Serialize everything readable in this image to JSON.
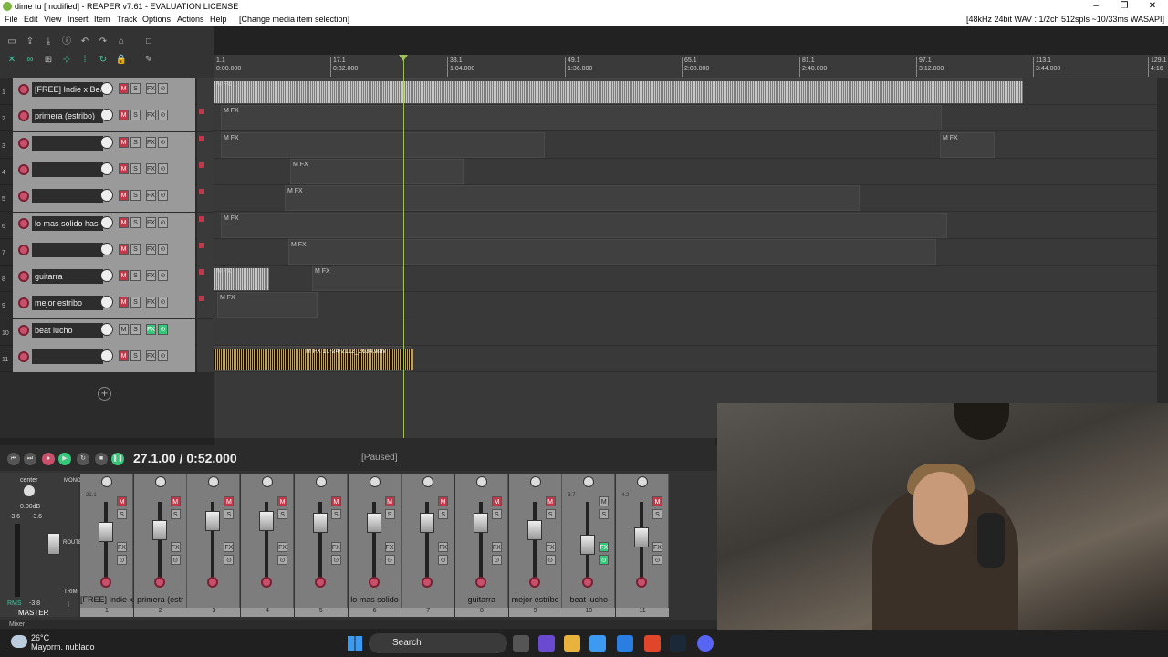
{
  "window": {
    "title": "dime tu [modified] - REAPER v7.61 - EVALUATION LICENSE",
    "minimize": "–",
    "maximize": "❐",
    "close": "✕"
  },
  "menu": {
    "items": [
      "File",
      "Edit",
      "View",
      "Insert",
      "Item",
      "Track",
      "Options",
      "Actions",
      "Help",
      "[Change media item selection]"
    ],
    "audio_status": "[48kHz 24bit WAV : 1/2ch 512spls ~10/33ms WASAPI]"
  },
  "ruler": {
    "marks": [
      {
        "bar": "1.1",
        "time": "0:00.000"
      },
      {
        "bar": "17.1",
        "time": "0:32.000"
      },
      {
        "bar": "33.1",
        "time": "1:04.000"
      },
      {
        "bar": "49.1",
        "time": "1:36.000"
      },
      {
        "bar": "65.1",
        "time": "2:08.000"
      },
      {
        "bar": "81.1",
        "time": "2:40.000"
      },
      {
        "bar": "97.1",
        "time": "3:12.000"
      },
      {
        "bar": "113.1",
        "time": "3:44.000"
      },
      {
        "bar": "129.1",
        "time": "4:16"
      }
    ]
  },
  "tracks": [
    {
      "num": "1",
      "name": "[FREE] Indie x Bed"
    },
    {
      "num": "2",
      "name": "primera (estribo)"
    },
    {
      "num": "3",
      "name": ""
    },
    {
      "num": "4",
      "name": ""
    },
    {
      "num": "5",
      "name": ""
    },
    {
      "num": "6",
      "name": "lo mas solido has"
    },
    {
      "num": "7",
      "name": ""
    },
    {
      "num": "8",
      "name": "guitarra"
    },
    {
      "num": "9",
      "name": "mejor estribo"
    },
    {
      "num": "10",
      "name": "beat lucho"
    },
    {
      "num": "11",
      "name": ""
    }
  ],
  "track_buttons": {
    "mute": "M",
    "solo": "S",
    "fx": "FX",
    "io": "⊙"
  },
  "item_label": "M FX",
  "item_label_11": "M FX 10-24-2112_2634.wav",
  "add_track": "+",
  "transport": {
    "time": "27.1.00 / 0:52.000",
    "status": "[Paused]"
  },
  "mixer": {
    "master_label": "MASTER",
    "pan": "center",
    "db": "0.00dB",
    "peaks": [
      "-3.6",
      "-3.6"
    ],
    "rms": "RMS",
    "rms_val": "-3.8",
    "mono": "MONO",
    "route": "ROUTE",
    "trim": "TRIM",
    "info": "i",
    "strip_labels": [
      "[FREE] Indie x",
      "primera (estr",
      "",
      "",
      "",
      "lo mas solido",
      "",
      "guitarra",
      "mejor estribo",
      "beat lucho",
      ""
    ],
    "strip_nums": [
      "1",
      "2",
      "3",
      "4",
      "5",
      "6",
      "7",
      "8",
      "9",
      "10",
      "11"
    ],
    "strip_db": [
      "-21.1",
      "",
      "",
      "",
      "",
      "",
      "",
      "",
      "",
      "-3.7",
      "-4.2"
    ]
  },
  "mixer_tab": "Mixer",
  "taskbar": {
    "temp": "26°C",
    "weather": "Mayorm. nublado",
    "search": "Search"
  }
}
